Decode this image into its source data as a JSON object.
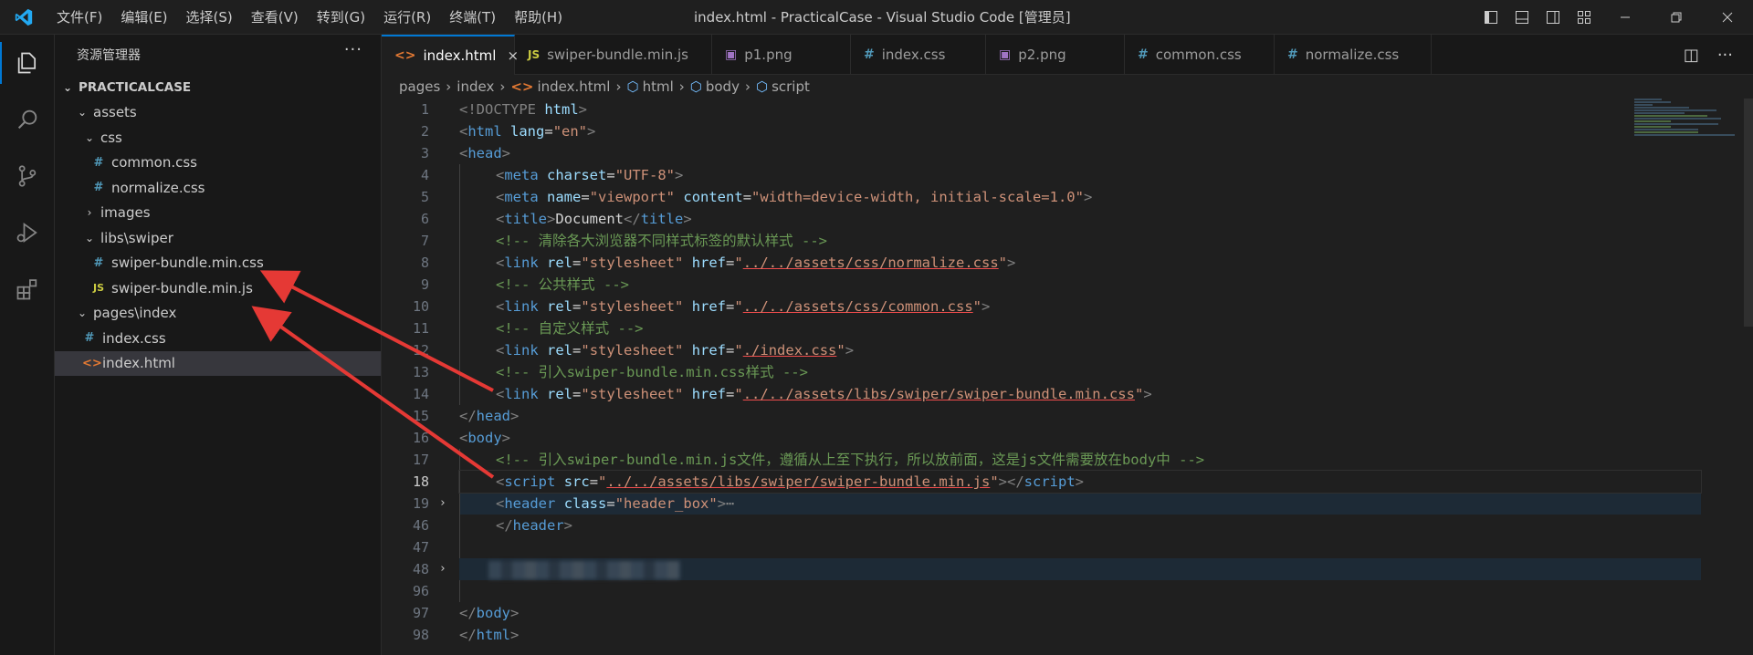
{
  "titlebar": {
    "menu": [
      "文件(F)",
      "编辑(E)",
      "选择(S)",
      "查看(V)",
      "转到(G)",
      "运行(R)",
      "终端(T)",
      "帮助(H)"
    ],
    "title": "index.html - PracticalCase - Visual Studio Code [管理员]"
  },
  "sidebar": {
    "title": "资源管理器",
    "more": "···",
    "tree": [
      {
        "label": "PRACTICALCASE",
        "chevron": "⌄"
      },
      {
        "label": "assets",
        "chevron": "⌄"
      },
      {
        "label": "css",
        "chevron": "⌄"
      },
      {
        "label": "common.css",
        "icon": "#"
      },
      {
        "label": "normalize.css",
        "icon": "#"
      },
      {
        "label": "images",
        "chevron": "›"
      },
      {
        "label": "libs\\swiper",
        "chevron": "⌄"
      },
      {
        "label": "swiper-bundle.min.css",
        "icon": "#"
      },
      {
        "label": "swiper-bundle.min.js",
        "icon": "JS"
      },
      {
        "label": "pages\\index",
        "chevron": "⌄"
      },
      {
        "label": "index.css",
        "icon": "#"
      },
      {
        "label": "index.html",
        "icon": "<>"
      }
    ]
  },
  "tabs": [
    {
      "label": "index.html",
      "icon": "<>",
      "close": "×"
    },
    {
      "label": "swiper-bundle.min.js",
      "icon": "JS"
    },
    {
      "label": "p1.png",
      "icon": "▣"
    },
    {
      "label": "index.css",
      "icon": "#"
    },
    {
      "label": "p2.png",
      "icon": "▣"
    },
    {
      "label": "common.css",
      "icon": "#"
    },
    {
      "label": "normalize.css",
      "icon": "#"
    }
  ],
  "tab_actions": {
    "split": "◫",
    "more": "···"
  },
  "breadcrumb": [
    "pages",
    "index",
    "index.html",
    "html",
    "body",
    "script"
  ],
  "editor": {
    "line_numbers": [
      "1",
      "2",
      "3",
      "4",
      "5",
      "6",
      "7",
      "8",
      "9",
      "10",
      "11",
      "12",
      "13",
      "14",
      "15",
      "16",
      "17",
      "18",
      "19",
      "46",
      "47",
      "48",
      "96",
      "97",
      "98"
    ],
    "current_line": "18",
    "code": {
      "l1_tag": "<!DOCTYPE",
      "l1_name": "html",
      "l1_end": ">",
      "html": "html",
      "lang_attr": "lang",
      "lang_val": "\"en\"",
      "head": "head",
      "meta": "meta",
      "charset_attr": "charset",
      "charset_val": "\"UTF-8\"",
      "name_attr": "name",
      "viewport_val": "\"viewport\"",
      "content_attr": "content",
      "content_val": "\"width=device-width, initial-scale=1.0\"",
      "title": "title",
      "title_text": "Document",
      "c7": "<!-- 清除各大浏览器不同样式标签的默认样式 -->",
      "link": "link",
      "rel_attr": "rel",
      "rel_val": "\"stylesheet\"",
      "href_attr": "href",
      "href8": "../../assets/css/normalize.css",
      "c9": "<!-- 公共样式 -->",
      "href10": "../../assets/css/common.css",
      "c11": "<!-- 自定义样式 -->",
      "href12": "./index.css",
      "c13": "<!-- 引入swiper-bundle.min.css样式 -->",
      "href14": "../../assets/libs/swiper/swiper-bundle.min.css",
      "body": "body",
      "c17": "<!-- 引入swiper-bundle.min.js文件，遵循从上至下执行，所以放前面，这是js文件需要放在body中 -->",
      "script": "script",
      "src_attr": "src",
      "src18": "../../assets/libs/swiper/swiper-bundle.min.js",
      "header": "header",
      "class_attr": "class",
      "class_val": "\"header_box\"",
      "ellipsis": "⋯"
    }
  },
  "colors": {
    "accent": "#0078d4",
    "annotation_arrow": "#e53935"
  }
}
